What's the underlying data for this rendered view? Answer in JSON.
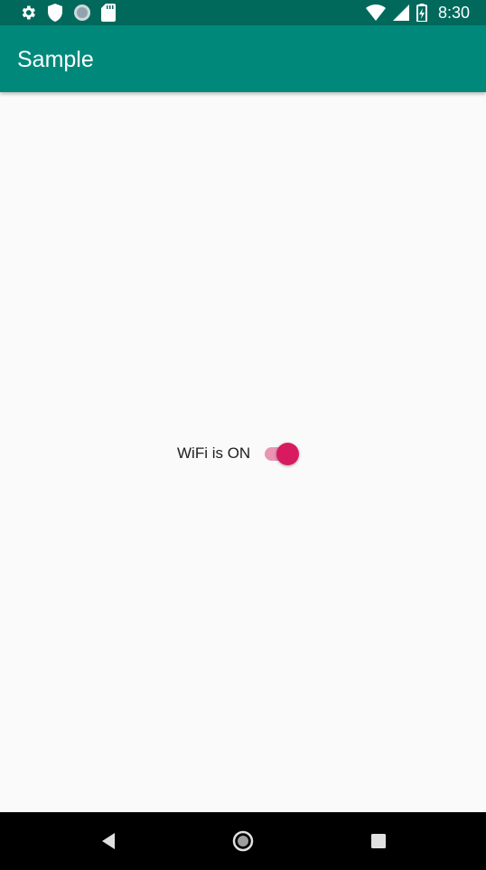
{
  "status_bar": {
    "time": "8:30",
    "left_icons": [
      "settings-gear-icon",
      "shield-icon",
      "sync-circle-icon",
      "sd-card-icon"
    ],
    "right_icons": [
      "wifi-icon",
      "cell-signal-icon",
      "battery-charging-icon"
    ]
  },
  "app_bar": {
    "title": "Sample",
    "color": "#00897b"
  },
  "main": {
    "wifi_label": "WiFi is ON",
    "wifi_switch_on": true,
    "accent_color": "#d81b60"
  },
  "nav_bar": {
    "buttons": [
      "back-icon",
      "home-icon",
      "recents-icon"
    ]
  }
}
